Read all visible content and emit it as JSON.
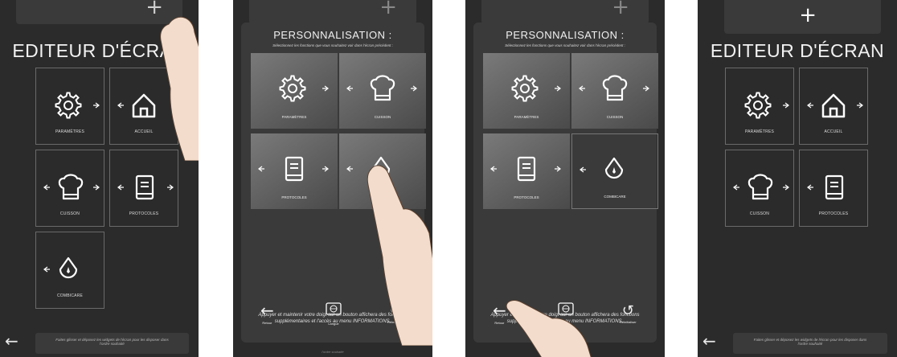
{
  "editor": {
    "title": "EDITEUR D'ÉCRAN",
    "plus": "+",
    "back": "←",
    "footer_text": "Faites glisser et déposez les widgets de l'écran pour les disposer dans l'ordre souhaité",
    "tiles": [
      {
        "label": "PARAMÈTRES",
        "icon": "gear-icon"
      },
      {
        "label": "ACCUEIL",
        "icon": "home-icon"
      },
      {
        "label": "CUISSON",
        "icon": "chef-hat-icon"
      },
      {
        "label": "PROTOCOLES",
        "icon": "book-icon"
      },
      {
        "label": "COMBICARE",
        "icon": "droplet-icon"
      }
    ]
  },
  "personalization": {
    "title": "PERSONNALISATION :",
    "subtitle": "Sélectionnez les fonctions que vous souhaitez voir dans l'écran précédent :",
    "tiles": [
      {
        "label": "PARAMÈTRES",
        "icon": "gear-icon"
      },
      {
        "label": "CUISSON",
        "icon": "chef-hat-icon"
      },
      {
        "label": "PROTOCOLES",
        "icon": "book-icon"
      },
      {
        "label": "COMBICARE",
        "icon": "droplet-icon"
      }
    ],
    "buttons": {
      "back": "Retour",
      "language": "Langue",
      "reset": "Réinitialiser"
    },
    "help": "Appuyer et maintenir votre doigt sur un bouton affichera des fonctions supplémentaires et l'accès au menu INFORMATIONS.",
    "footer": "l'ordre souhaité"
  },
  "final": {
    "tiles": [
      {
        "label": "PARAMÈTRES",
        "icon": "gear-icon"
      },
      {
        "label": "ACCUEIL",
        "icon": "home-icon"
      },
      {
        "label": "CUISSON",
        "icon": "chef-hat-icon"
      },
      {
        "label": "PROTOCOLES",
        "icon": "book-icon"
      }
    ]
  }
}
